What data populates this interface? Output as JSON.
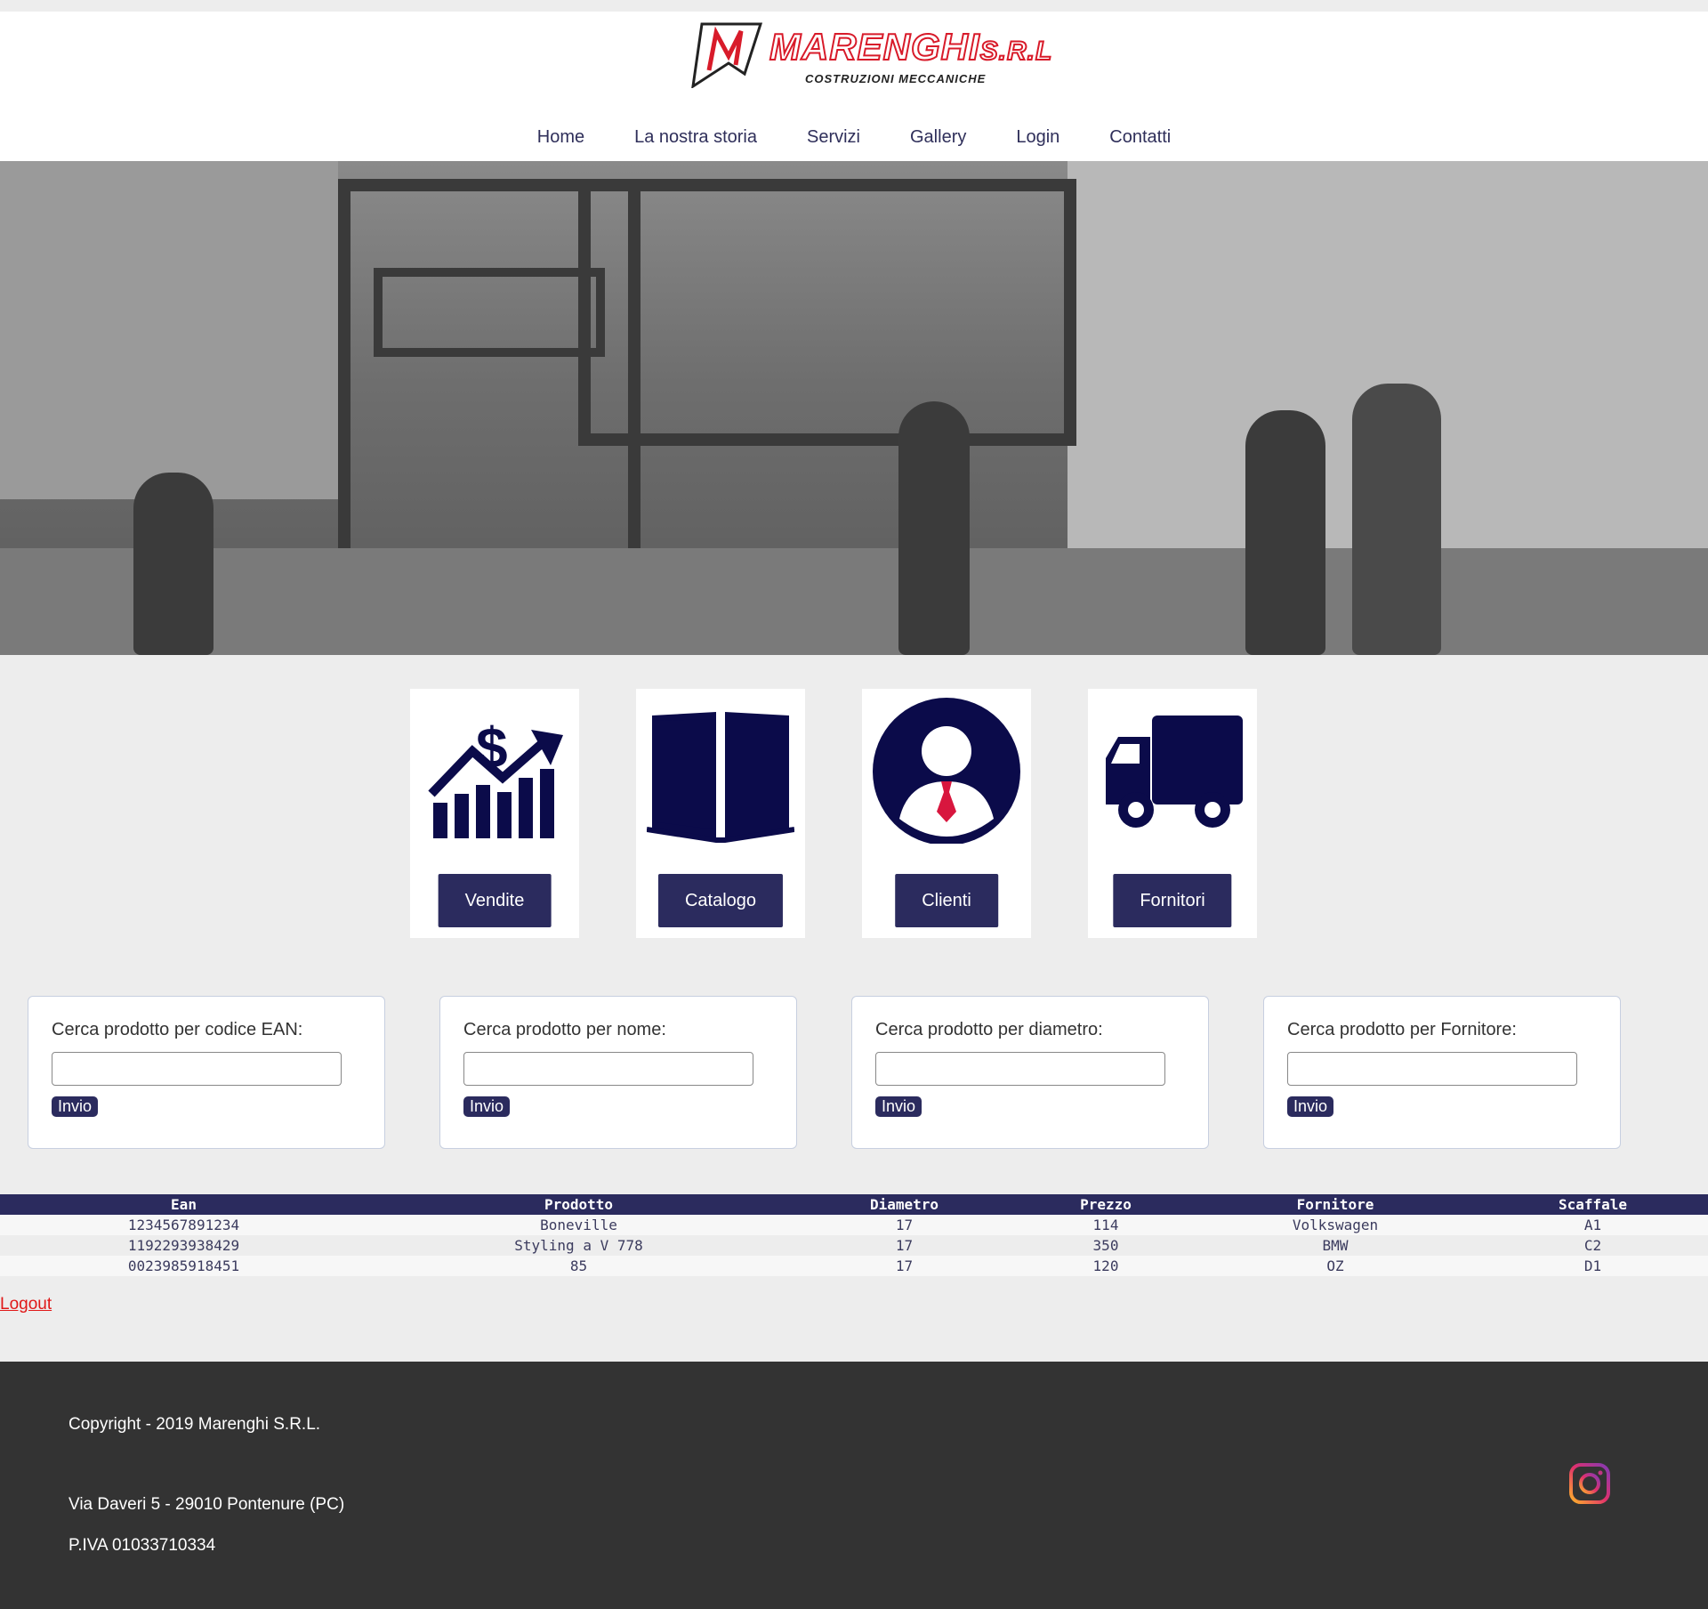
{
  "brand": {
    "name": "MARENGHI",
    "suffix": "S.R.L",
    "subtitle": "COSTRUZIONI MECCANICHE",
    "accent_color": "#d81b2a"
  },
  "nav": {
    "items": [
      "Home",
      "La nostra storia",
      "Servizi",
      "Gallery",
      "Login",
      "Contatti"
    ]
  },
  "hero": {
    "description_icon": "industrial-workshop-photo"
  },
  "cards": [
    {
      "icon": "sales-chart-dollar-icon",
      "label": "Vendite"
    },
    {
      "icon": "open-book-icon",
      "label": "Catalogo"
    },
    {
      "icon": "user-profile-icon",
      "label": "Clienti"
    },
    {
      "icon": "truck-icon",
      "label": "Fornitori"
    }
  ],
  "searches": [
    {
      "label": "Cerca prodotto per codice EAN:",
      "value": "",
      "button": "Invio"
    },
    {
      "label": "Cerca prodotto per nome:",
      "value": "",
      "button": "Invio"
    },
    {
      "label": "Cerca prodotto per diametro:",
      "value": "",
      "button": "Invio"
    },
    {
      "label": "Cerca prodotto per Fornitore:",
      "value": "",
      "button": "Invio"
    }
  ],
  "table": {
    "headers": [
      "Ean",
      "Prodotto",
      "Diametro",
      "Prezzo",
      "Fornitore",
      "Scaffale"
    ],
    "rows": [
      [
        "1234567891234",
        "Boneville",
        "17",
        "114",
        "Volkswagen",
        "A1"
      ],
      [
        "1192293938429",
        "Styling a V 778",
        "17",
        "350",
        "BMW",
        "C2"
      ],
      [
        "0023985918451",
        "85",
        "17",
        "120",
        "OZ",
        "D1"
      ]
    ]
  },
  "logout": "Logout",
  "footer": {
    "copyright": "Copyright - 2019 Marenghi S.R.L.",
    "address": "Via Daveri 5 - 29010 Pontenure (PC)",
    "piva": "P.IVA 01033710334",
    "social_icon": "instagram-icon"
  },
  "colors": {
    "primary": "#2b2b5e",
    "icon_navy": "#0b0b4a",
    "footer_bg": "#333333",
    "page_bg": "#ededed",
    "link_red": "#e01818"
  }
}
